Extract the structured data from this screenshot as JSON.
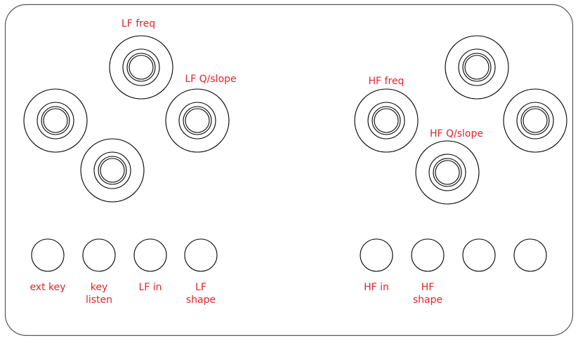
{
  "panel": {
    "label_color": "#e0242b",
    "outline_color": "#000000",
    "knobs": [
      {
        "id": "knob-lf-freq",
        "label": "LF freq"
      },
      {
        "id": "knob-lf-q-slope",
        "label": "LF Q/slope"
      },
      {
        "id": "knob-left-unlabeled-1",
        "label": ""
      },
      {
        "id": "knob-left-unlabeled-2",
        "label": ""
      },
      {
        "id": "knob-hf-freq",
        "label": "HF freq"
      },
      {
        "id": "knob-hf-q-slope",
        "label": "HF Q/slope"
      },
      {
        "id": "knob-right-unlabeled-1",
        "label": ""
      },
      {
        "id": "knob-right-unlabeled-2",
        "label": ""
      }
    ],
    "buttons": [
      {
        "id": "button-ext-key",
        "label": "ext key"
      },
      {
        "id": "button-key-listen",
        "label": "key\nlisten"
      },
      {
        "id": "button-lf-in",
        "label": "LF in"
      },
      {
        "id": "button-lf-shape",
        "label": "LF\nshape"
      },
      {
        "id": "button-hf-in",
        "label": "HF in"
      },
      {
        "id": "button-hf-shape",
        "label": "HF\nshape"
      },
      {
        "id": "button-right-unlabeled-1",
        "label": ""
      },
      {
        "id": "button-right-unlabeled-2",
        "label": ""
      }
    ]
  }
}
